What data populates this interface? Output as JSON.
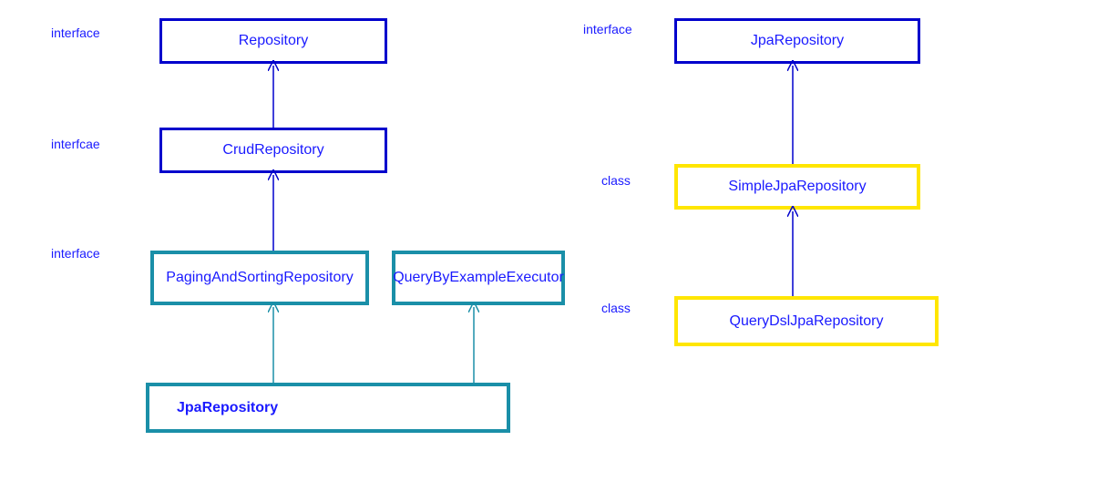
{
  "labels": {
    "l1": "interface",
    "l2": "interfcae",
    "l3": "interface",
    "l4": "interface",
    "l5": "class",
    "l6": "class"
  },
  "boxes": {
    "repository": "Repository",
    "crud": "CrudRepository",
    "paging": "PagingAndSortingRepository",
    "qbe": "QueryByExampleExecutor",
    "jpa_left": "JpaRepository",
    "jpa_right": "JpaRepository",
    "simple": "SimpleJpaRepository",
    "querydsl": "QueryDslJpaRepository"
  },
  "chart_data": {
    "type": "diagram",
    "title": "Spring Data JPA Repository Hierarchy",
    "hierarchies": [
      {
        "nodes": [
          {
            "id": "repository",
            "name": "Repository",
            "stereotype": "interface",
            "border_color": "#0000cc"
          },
          {
            "id": "crud",
            "name": "CrudRepository",
            "stereotype": "interfcae",
            "border_color": "#0000cc"
          },
          {
            "id": "paging",
            "name": "PagingAndSortingRepository",
            "stereotype": "interface",
            "border_color": "#1a8fa8"
          },
          {
            "id": "qbe",
            "name": "QueryByExampleExecutor",
            "stereotype": "interface",
            "border_color": "#1a8fa8"
          },
          {
            "id": "jpa_left",
            "name": "JpaRepository",
            "stereotype": "interface",
            "border_color": "#1a8fa8"
          }
        ],
        "edges": [
          {
            "from": "crud",
            "to": "repository",
            "color": "#0000cc"
          },
          {
            "from": "paging",
            "to": "crud",
            "color": "#0000cc"
          },
          {
            "from": "jpa_left",
            "to": "paging",
            "color": "#1a8fa8"
          },
          {
            "from": "jpa_left",
            "to": "qbe",
            "color": "#1a8fa8"
          }
        ]
      },
      {
        "nodes": [
          {
            "id": "jpa_right",
            "name": "JpaRepository",
            "stereotype": "interface",
            "border_color": "#0000cc"
          },
          {
            "id": "simple",
            "name": "SimpleJpaRepository",
            "stereotype": "class",
            "border_color": "#ffe600"
          },
          {
            "id": "querydsl",
            "name": "QueryDslJpaRepository",
            "stereotype": "class",
            "border_color": "#ffe600"
          }
        ],
        "edges": [
          {
            "from": "simple",
            "to": "jpa_right",
            "color": "#0000cc"
          },
          {
            "from": "querydsl",
            "to": "simple",
            "color": "#0000cc"
          }
        ]
      }
    ]
  }
}
